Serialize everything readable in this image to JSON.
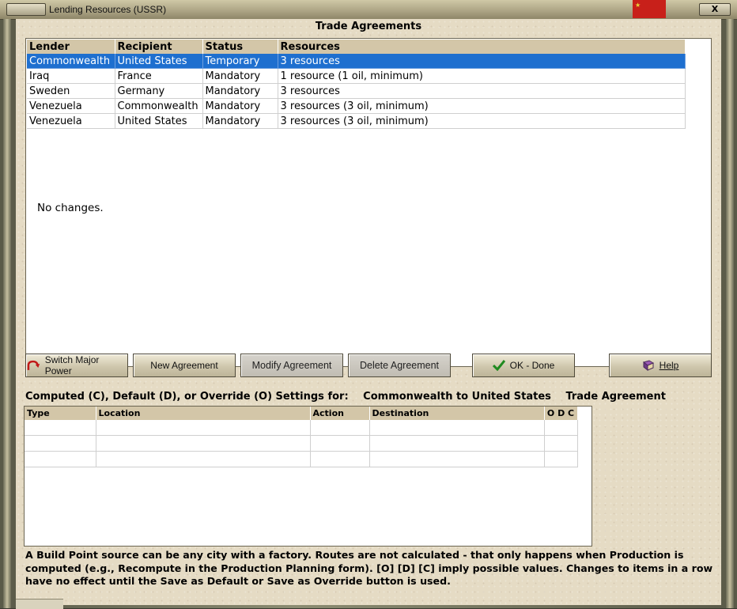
{
  "window": {
    "title": "Lending Resources (USSR)",
    "close_label": "X"
  },
  "page_title": "Trade Agreements",
  "agreements": {
    "columns": [
      "Lender",
      "Recipient",
      "Status",
      "Resources"
    ],
    "rows": [
      {
        "lender": "Commonwealth",
        "recipient": "United States",
        "status": "Temporary",
        "resources": "3 resources"
      },
      {
        "lender": "Iraq",
        "recipient": "France",
        "status": "Mandatory",
        "resources": "1 resource (1 oil, minimum)"
      },
      {
        "lender": "Sweden",
        "recipient": "Germany",
        "status": "Mandatory",
        "resources": "3 resources"
      },
      {
        "lender": "Venezuela",
        "recipient": "Commonwealth",
        "status": "Mandatory",
        "resources": "3 resources (3 oil, minimum)"
      },
      {
        "lender": "Venezuela",
        "recipient": "United States",
        "status": "Mandatory",
        "resources": "3 resources (3 oil, minimum)"
      }
    ],
    "selected_row": 0,
    "message": "No changes."
  },
  "buttons": {
    "switch_major_power": "Switch Major Power",
    "new_agreement": "New Agreement",
    "modify_agreement": "Modify Agreement",
    "delete_agreement": "Delete Agreement",
    "ok_done": "OK - Done",
    "help": "Help"
  },
  "settings": {
    "label": "Computed (C), Default (D), or Override (O) Settings for:",
    "target": "Commonwealth to United States",
    "kind": "Trade Agreement",
    "columns": [
      "Type",
      "Location",
      "Action",
      "Destination",
      "O D C"
    ]
  },
  "footer_note": "A Build Point source can be any city with a factory. Routes are not calculated - that only happens when Production is computed (e.g., Recompute in the Production Planning form). [O] [D] [C] imply possible values. Changes to items in a row have no effect until the Save as Default or Save as Override button is used.",
  "icons": {
    "switch_major_power": "curved-arrow-icon",
    "ok_done": "checkmark-icon",
    "help": "book-icon",
    "flag": "ussr-flag-icon"
  },
  "colors": {
    "selection": "#1e6fcf",
    "header": "#d3c6a8",
    "panel": "#e5dbc4",
    "ok_check": "#1f8a1f",
    "arrow": "#c01818"
  }
}
